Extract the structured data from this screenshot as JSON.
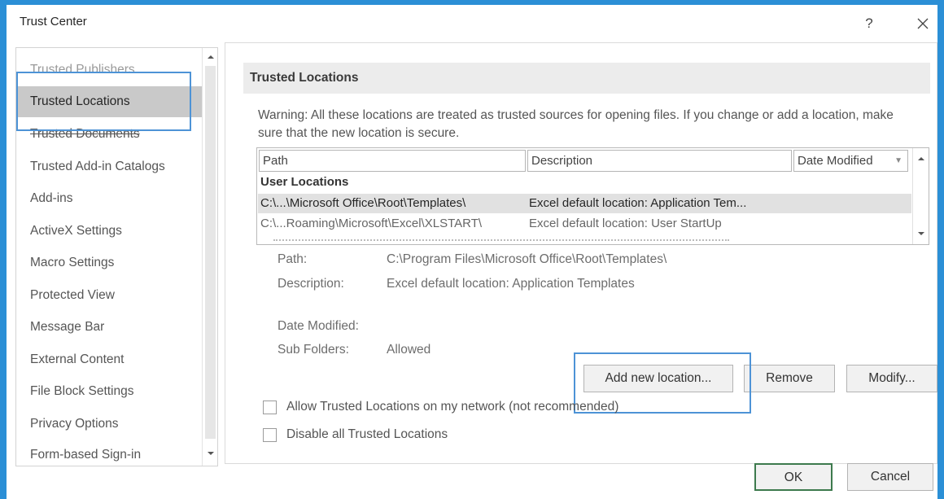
{
  "dialog": {
    "title": "Trust Center",
    "help_glyph": "?"
  },
  "sidebar": {
    "items": [
      {
        "label": "Trusted Publishers",
        "state": "cutoff"
      },
      {
        "label": "Trusted Locations",
        "state": "selected"
      },
      {
        "label": "Trusted Documents",
        "state": "struck"
      },
      {
        "label": "Trusted Add-in Catalogs",
        "state": "normal"
      },
      {
        "label": "Add-ins",
        "state": "normal"
      },
      {
        "label": "ActiveX Settings",
        "state": "normal"
      },
      {
        "label": "Macro Settings",
        "state": "normal"
      },
      {
        "label": "Protected View",
        "state": "normal"
      },
      {
        "label": "Message Bar",
        "state": "normal"
      },
      {
        "label": "External Content",
        "state": "normal"
      },
      {
        "label": "File Block Settings",
        "state": "normal"
      },
      {
        "label": "Privacy Options",
        "state": "normal"
      },
      {
        "label": "Form-based Sign-in",
        "state": "normal"
      }
    ]
  },
  "main": {
    "section_title": "Trusted Locations",
    "warning_text": "Warning: All these locations are treated as trusted sources for opening files.  If you change or add a location, make sure that the new location is secure.",
    "table": {
      "columns": [
        "Path",
        "Description",
        "Date Modified"
      ],
      "group_label": "User Locations",
      "rows": [
        {
          "path": "C:\\...\\Microsoft Office\\Root\\Templates\\",
          "description": "Excel default location: Application Tem...",
          "selected": true
        },
        {
          "path": "C:\\...Roaming\\Microsoft\\Excel\\XLSTART\\",
          "description": "Excel default location: User StartUp",
          "selected": false
        }
      ]
    },
    "details": {
      "path_label": "Path:",
      "path_value": "C:\\Program Files\\Microsoft Office\\Root\\Templates\\",
      "description_label": "Description:",
      "description_value": "Excel default location: Application Templates",
      "date_modified_label": "Date Modified:",
      "date_modified_value": "",
      "sub_folders_label": "Sub Folders:",
      "sub_folders_value": "Allowed"
    },
    "buttons": {
      "add_new_location": "Add new location...",
      "remove": "Remove",
      "modify": "Modify..."
    },
    "checkboxes": {
      "allow_network": {
        "label": "Allow Trusted Locations on my network (not recommended)",
        "checked": false
      },
      "disable_all": {
        "label": "Disable all Trusted Locations",
        "checked": false
      }
    }
  },
  "footer": {
    "ok": "OK",
    "cancel": "Cancel"
  },
  "colors": {
    "window_frame": "#2b8fd6",
    "selection_highlight": "#4d93d6",
    "ok_border": "#3d7a4d"
  }
}
